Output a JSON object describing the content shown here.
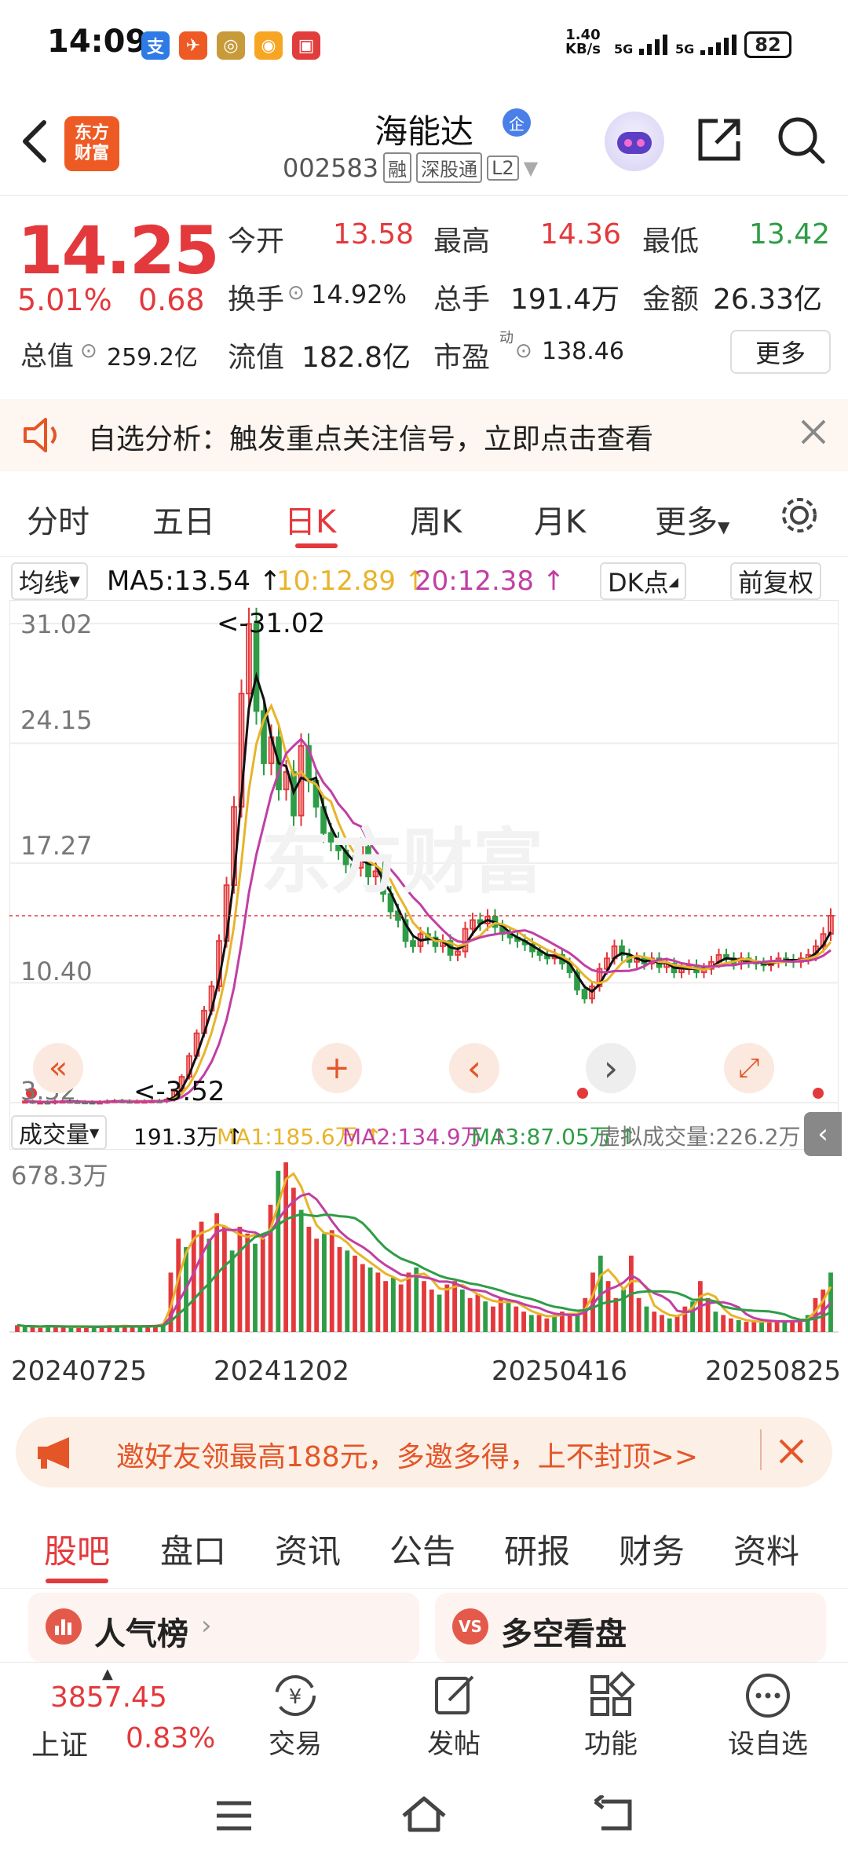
{
  "status_bar": {
    "time": "14:09",
    "net_speed_top": "1.40",
    "net_speed_bottom": "KB/s",
    "sig1": "5G",
    "sig2": "5G",
    "battery": "82"
  },
  "header": {
    "logo_line1": "东方",
    "logo_line2": "财富",
    "title": "海能达",
    "qi_badge": "企",
    "code": "002583",
    "tag_rong": "融",
    "tag_sgt": "深股通",
    "tag_l2": "L2"
  },
  "quote": {
    "price": "14.25",
    "pct": "5.01%",
    "chg": "0.68",
    "open_label": "今开",
    "open": "13.58",
    "high_label": "最高",
    "high": "14.36",
    "low_label": "最低",
    "low": "13.42",
    "turnover_label": "换手",
    "turnover": "14.92%",
    "volume_label": "总手",
    "volume": "191.4万",
    "amount_label": "金额",
    "amount": "26.33亿",
    "mktcap_label": "总值",
    "mktcap": "259.2亿",
    "float_label": "流值",
    "float": "182.8亿",
    "pe_label": "市盈",
    "pe_sup": "动",
    "pe": "138.46",
    "more": "更多"
  },
  "notice": {
    "text": "自选分析：触发重点关注信号，立即点击查看"
  },
  "chart_tabs": [
    "分时",
    "五日",
    "日K",
    "周K",
    "月K",
    "更多"
  ],
  "chart_tab_active": 2,
  "ma_bar": {
    "select": "均线",
    "ma5": "MA5:13.54 ↑",
    "ma10": "10:12.89 ↑",
    "ma20": "20:12.38 ↑",
    "dk": "DK点",
    "fq": "前复权"
  },
  "vol_bar": {
    "select": "成交量",
    "vol": "191.3万 ↑",
    "ma1": "MA1:185.6万 ↑",
    "ma2": "MA2:134.9万 ↑",
    "ma3": "MA3:87.05万 ↑",
    "virt": "虚拟成交量:226.2万",
    "ymax": "678.3万"
  },
  "chart_data": {
    "type": "candlestick",
    "y_ticks": [
      "31.02",
      "24.15",
      "17.27",
      "10.40",
      "3.52"
    ],
    "ylim": [
      3.52,
      31.02
    ],
    "max_annotation": "<-31.02",
    "min_annotation": "<-3.52",
    "x_ticks": [
      "20240725",
      "20241202",
      "20250416",
      "20250825"
    ],
    "last_price": 14.25,
    "close_series": [
      3.6,
      3.55,
      3.55,
      3.52,
      3.6,
      3.6,
      3.58,
      3.56,
      3.55,
      3.54,
      3.55,
      3.6,
      3.62,
      3.6,
      3.58,
      3.6,
      3.6,
      3.62,
      3.6,
      3.7,
      4.2,
      5.0,
      6.2,
      7.5,
      8.8,
      10.2,
      12.8,
      16.0,
      20.5,
      27.0,
      31.0,
      26.0,
      23.0,
      24.5,
      21.5,
      22.5,
      20.0,
      24.0,
      22.0,
      20.5,
      19.0,
      18.5,
      18.0,
      17.2,
      17.0,
      18.2,
      16.5,
      16.8,
      15.5,
      14.5,
      14.0,
      12.8,
      12.5,
      13.2,
      13.0,
      12.5,
      12.8,
      12.0,
      12.2,
      13.5,
      14.0,
      13.8,
      14.2,
      13.6,
      13.2,
      13.0,
      12.8,
      12.6,
      12.2,
      12.0,
      11.8,
      12.0,
      11.5,
      11.0,
      10.0,
      9.5,
      10.2,
      11.2,
      11.8,
      12.5,
      12.0,
      11.6,
      11.8,
      11.5,
      11.8,
      11.3,
      11.5,
      11.0,
      11.2,
      11.4,
      11.0,
      11.2,
      11.6,
      12.0,
      11.8,
      11.5,
      11.8,
      11.6,
      11.5,
      11.4,
      11.6,
      11.8,
      11.7,
      11.6,
      11.8,
      12.0,
      12.5,
      13.2,
      14.25
    ],
    "ma5": "MA5:13.54",
    "ma10": "MA10:12.89",
    "ma20": "MA20:12.38",
    "volume_max": "678.3万",
    "volume_series": [
      0.04,
      0.03,
      0.03,
      0.03,
      0.04,
      0.03,
      0.03,
      0.03,
      0.03,
      0.03,
      0.03,
      0.03,
      0.04,
      0.03,
      0.04,
      0.03,
      0.03,
      0.04,
      0.04,
      0.05,
      0.35,
      0.55,
      0.5,
      0.6,
      0.65,
      0.55,
      0.7,
      0.62,
      0.48,
      0.62,
      0.58,
      0.52,
      0.55,
      0.75,
      0.95,
      1.0,
      0.85,
      0.72,
      0.62,
      0.55,
      0.58,
      0.6,
      0.5,
      0.48,
      0.45,
      0.4,
      0.38,
      0.35,
      0.3,
      0.32,
      0.28,
      0.35,
      0.38,
      0.3,
      0.25,
      0.22,
      0.28,
      0.3,
      0.25,
      0.2,
      0.22,
      0.18,
      0.15,
      0.2,
      0.18,
      0.15,
      0.12,
      0.1,
      0.1,
      0.08,
      0.1,
      0.12,
      0.1,
      0.1,
      0.2,
      0.35,
      0.45,
      0.3,
      0.2,
      0.25,
      0.45,
      0.2,
      0.15,
      0.12,
      0.1,
      0.08,
      0.1,
      0.15,
      0.18,
      0.3,
      0.2,
      0.12,
      0.1,
      0.08,
      0.07,
      0.06,
      0.06,
      0.06,
      0.07,
      0.06,
      0.06,
      0.07,
      0.06,
      0.1,
      0.2,
      0.25,
      0.35
    ]
  },
  "chart_controls": [
    "«",
    "+",
    "‹",
    "›",
    "⤢"
  ],
  "banner": {
    "text": "邀好友领最高188元，多邀多得，上不封顶>>"
  },
  "content_tabs": [
    "股吧",
    "盘口",
    "资讯",
    "公告",
    "研报",
    "财务",
    "资料"
  ],
  "cards": {
    "left": "人气榜",
    "right": "多空看盘",
    "vs": "VS"
  },
  "bottom_nav": {
    "index_value": "3857.45",
    "index_name": "上证",
    "index_pct": "0.83%",
    "trade": "交易",
    "post": "发帖",
    "func": "功能",
    "watch": "设自选"
  },
  "colors": {
    "up": "#e4393c",
    "down": "#2e9d46",
    "ma5": "#111111",
    "ma10": "#e8b42a",
    "ma20": "#c13fa3",
    "brand": "#ee5a24"
  }
}
